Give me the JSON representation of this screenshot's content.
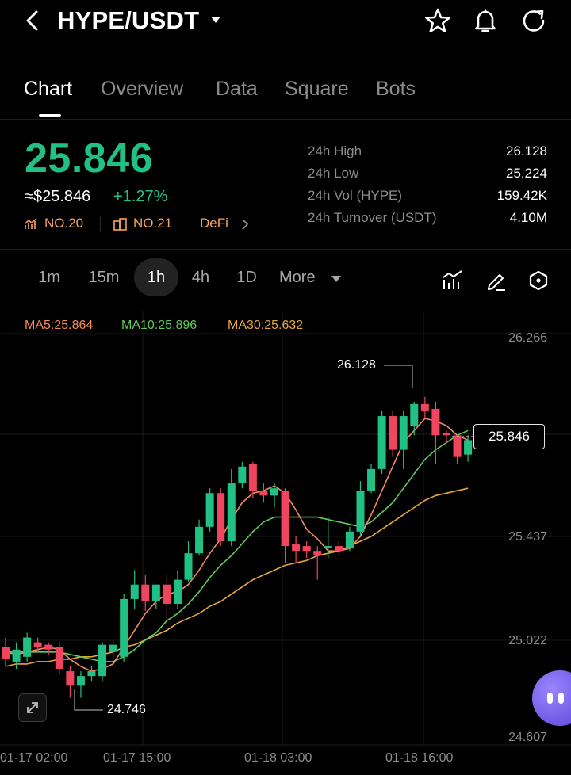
{
  "header": {
    "pair": "HYPE/USDT",
    "icons": [
      "back-arrow-icon",
      "caret-down-icon",
      "star-icon",
      "bell-icon",
      "share-icon"
    ]
  },
  "tabs": [
    "Chart",
    "Overview",
    "Data",
    "Square",
    "Bots"
  ],
  "active_tab": "Chart",
  "ticker": {
    "price": "25.846",
    "fiat": "≈$25.846",
    "change": "+1.27%",
    "badges": [
      "NO.20",
      "NO.21",
      "DeFi"
    ]
  },
  "stats": [
    {
      "label": "24h  High",
      "value": "26.128"
    },
    {
      "label": "24h  Low",
      "value": "25.224"
    },
    {
      "label": "24h  Vol (HYPE)",
      "value": "159.42K"
    },
    {
      "label": "24h  Turnover (USDT)",
      "value": "4.10M"
    }
  ],
  "timeframes": [
    "1m",
    "15m",
    "1h",
    "4h",
    "1D"
  ],
  "active_timeframe": "1h",
  "more_label": "More",
  "ma_legend": {
    "ma5": "MA5:25.864",
    "ma10": "MA10:25.896",
    "ma30": "MA30:25.632"
  },
  "colors": {
    "up": "#21c084",
    "down": "#f0455e",
    "ma5": "#f38b5b",
    "ma10": "#62c95a",
    "ma30": "#e8a63a",
    "badge": "#f7a35c"
  },
  "chart_data": {
    "type": "candlestick",
    "y_ticks": [
      "26.266",
      "25.437",
      "25.022",
      "24.607"
    ],
    "ylim": [
      24.607,
      26.266
    ],
    "x_ticks": [
      "01-17 02:00",
      "01-17 15:00",
      "01-18 03:00",
      "01-18 16:00"
    ],
    "last_price_tag": "25.846",
    "high_label": "26.128",
    "low_label": "24.746",
    "candles": [
      {
        "o": 24.98,
        "h": 25.02,
        "c": 24.93,
        "l": 24.9
      },
      {
        "o": 24.92,
        "h": 25.0,
        "c": 24.97,
        "l": 24.89
      },
      {
        "o": 24.94,
        "h": 25.04,
        "c": 25.02,
        "l": 24.92
      },
      {
        "o": 25.0,
        "h": 25.02,
        "c": 24.98,
        "l": 24.96
      },
      {
        "o": 24.99,
        "h": 25.0,
        "c": 24.97,
        "l": 24.95
      },
      {
        "o": 24.98,
        "h": 25.0,
        "c": 24.89,
        "l": 24.87
      },
      {
        "o": 24.88,
        "h": 24.9,
        "c": 24.82,
        "l": 24.77
      },
      {
        "o": 24.82,
        "h": 24.88,
        "c": 24.86,
        "l": 24.77
      },
      {
        "o": 24.86,
        "h": 24.9,
        "c": 24.88,
        "l": 24.84
      },
      {
        "o": 24.86,
        "h": 25.0,
        "c": 24.99,
        "l": 24.84
      },
      {
        "o": 24.96,
        "h": 25.01,
        "c": 24.99,
        "l": 24.93
      },
      {
        "o": 24.94,
        "h": 25.2,
        "c": 25.18,
        "l": 24.92
      },
      {
        "o": 25.18,
        "h": 25.3,
        "c": 25.24,
        "l": 25.14
      },
      {
        "o": 25.24,
        "h": 25.28,
        "c": 25.17,
        "l": 25.13
      },
      {
        "o": 25.17,
        "h": 25.24,
        "c": 25.24,
        "l": 25.14
      },
      {
        "o": 25.24,
        "h": 25.28,
        "c": 25.16,
        "l": 25.1
      },
      {
        "o": 25.16,
        "h": 25.3,
        "c": 25.26,
        "l": 25.14
      },
      {
        "o": 25.26,
        "h": 25.42,
        "c": 25.37,
        "l": 25.25
      },
      {
        "o": 25.37,
        "h": 25.51,
        "c": 25.48,
        "l": 25.36
      },
      {
        "o": 25.48,
        "h": 25.64,
        "c": 25.62,
        "l": 25.46
      },
      {
        "o": 25.62,
        "h": 25.64,
        "c": 25.42,
        "l": 25.4
      },
      {
        "o": 25.42,
        "h": 25.72,
        "c": 25.66,
        "l": 25.4
      },
      {
        "o": 25.66,
        "h": 25.75,
        "c": 25.73,
        "l": 25.64
      },
      {
        "o": 25.74,
        "h": 25.75,
        "c": 25.63,
        "l": 25.6
      },
      {
        "o": 25.63,
        "h": 25.66,
        "c": 25.61,
        "l": 25.58
      },
      {
        "o": 25.61,
        "h": 25.66,
        "c": 25.64,
        "l": 25.56
      },
      {
        "o": 25.63,
        "h": 25.64,
        "c": 25.4,
        "l": 25.33
      },
      {
        "o": 25.41,
        "h": 25.44,
        "c": 25.38,
        "l": 25.33
      },
      {
        "o": 25.4,
        "h": 25.42,
        "c": 25.38,
        "l": 25.35
      },
      {
        "o": 25.38,
        "h": 25.4,
        "c": 25.36,
        "l": 25.26
      },
      {
        "o": 25.4,
        "h": 25.52,
        "c": 25.4,
        "l": 25.35
      },
      {
        "o": 25.4,
        "h": 25.42,
        "c": 25.38,
        "l": 25.36
      },
      {
        "o": 25.39,
        "h": 25.48,
        "c": 25.46,
        "l": 25.38
      },
      {
        "o": 25.46,
        "h": 25.67,
        "c": 25.63,
        "l": 25.44
      },
      {
        "o": 25.63,
        "h": 25.74,
        "c": 25.72,
        "l": 25.62
      },
      {
        "o": 25.72,
        "h": 25.96,
        "c": 25.94,
        "l": 25.7
      },
      {
        "o": 25.94,
        "h": 25.96,
        "c": 25.8,
        "l": 25.77
      },
      {
        "o": 25.8,
        "h": 25.96,
        "c": 25.94,
        "l": 25.72
      },
      {
        "o": 25.9,
        "h": 26.0,
        "c": 25.99,
        "l": 25.86
      },
      {
        "o": 25.99,
        "h": 26.02,
        "c": 25.96,
        "l": 25.93
      },
      {
        "o": 25.97,
        "h": 26.0,
        "c": 25.86,
        "l": 25.74
      },
      {
        "o": 25.87,
        "h": 25.88,
        "c": 25.86,
        "l": 25.83
      },
      {
        "o": 25.86,
        "h": 25.86,
        "c": 25.77,
        "l": 25.74
      },
      {
        "o": 25.78,
        "h": 25.86,
        "c": 25.84,
        "l": 25.75
      }
    ],
    "ma5": [
      24.96,
      24.95,
      24.96,
      24.97,
      24.98,
      24.97,
      24.93,
      24.9,
      24.88,
      24.89,
      24.91,
      24.98,
      25.05,
      25.12,
      25.17,
      25.2,
      25.21,
      25.24,
      25.3,
      25.37,
      25.43,
      25.51,
      25.58,
      25.62,
      25.63,
      25.65,
      25.62,
      25.55,
      25.47,
      25.43,
      25.38,
      25.38,
      25.39,
      25.44,
      25.53,
      25.63,
      25.73,
      25.83,
      25.88,
      25.93,
      25.92,
      25.9,
      25.86,
      25.84
    ],
    "ma10": [
      24.96,
      24.96,
      24.96,
      24.96,
      24.96,
      24.96,
      24.95,
      24.94,
      24.93,
      24.92,
      24.92,
      24.94,
      24.97,
      25.01,
      25.04,
      25.09,
      25.12,
      25.16,
      25.21,
      25.27,
      25.32,
      25.36,
      25.41,
      25.46,
      25.5,
      25.52,
      25.52,
      25.52,
      25.52,
      25.52,
      25.51,
      25.5,
      25.49,
      25.48,
      25.5,
      25.54,
      25.58,
      25.64,
      25.7,
      25.76,
      25.8,
      25.83,
      25.86,
      25.88
    ],
    "ma30": [
      24.9,
      24.91,
      24.91,
      24.92,
      24.92,
      24.93,
      24.93,
      24.94,
      24.94,
      24.95,
      24.96,
      24.98,
      24.99,
      25.01,
      25.03,
      25.05,
      25.08,
      25.1,
      25.12,
      25.15,
      25.17,
      25.2,
      25.23,
      25.26,
      25.28,
      25.3,
      25.32,
      25.33,
      25.34,
      25.36,
      25.37,
      25.38,
      25.4,
      25.42,
      25.44,
      25.47,
      25.5,
      25.53,
      25.56,
      25.59,
      25.61,
      25.62,
      25.63,
      25.64
    ]
  }
}
